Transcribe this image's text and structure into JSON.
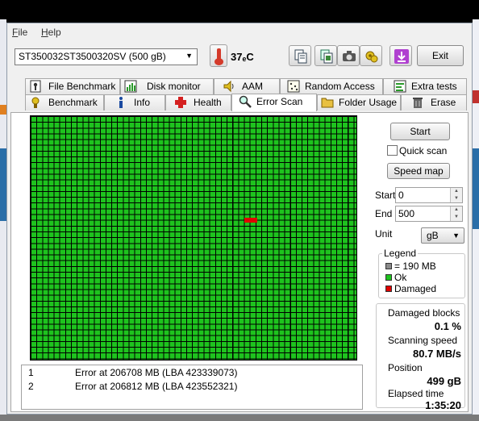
{
  "menu": {
    "file": "File",
    "file_u": "F",
    "file_rest": "ile",
    "help_u": "H",
    "help_rest": "elp"
  },
  "toolbar": {
    "drive": "ST350032ST3500320SV (500 gB)",
    "temperature": "37ₑC",
    "exit_label": "Exit",
    "icons": [
      "copy-icon",
      "copy-all-icon",
      "camera-icon",
      "options-icon",
      "save-icon"
    ]
  },
  "tabs": {
    "row1": [
      "File Benchmark",
      "Disk monitor",
      "AAM",
      "Random Access",
      "Extra tests"
    ],
    "row2": [
      "Benchmark",
      "Info",
      "Health",
      "Error Scan",
      "Folder Usage",
      "Erase"
    ],
    "active": "Error Scan"
  },
  "scan": {
    "grid_columns": 56,
    "grid_rows": 42,
    "ok_color": "#1ec31e",
    "damaged_color": "#e00000",
    "damaged_block_fraction": 0.001,
    "errors": [
      {
        "num": "1",
        "text": "Error at 206708 MB (LBA 423339073)"
      },
      {
        "num": "2",
        "text": "Error at 206812 MB (LBA 423552321)"
      }
    ]
  },
  "controls": {
    "start_label": "Start",
    "quick_scan_label": "Quick scan",
    "quick_scan_checked": false,
    "speed_map_label": "Speed map",
    "start_field_label": "Start",
    "start_value": "0",
    "end_field_label": "End",
    "end_value": "500",
    "unit_label": "Unit",
    "unit_value": "gB"
  },
  "legend": {
    "title": "Legend",
    "block_size": "= 190 MB",
    "ok": "Ok",
    "damaged": "Damaged"
  },
  "stats": {
    "damaged_blocks_label": "Damaged blocks",
    "damaged_blocks_value": "0.1 %",
    "scanning_speed_label": "Scanning speed",
    "scanning_speed_value": "80.7 MB/s",
    "position_label": "Position",
    "position_value": "499 gB",
    "elapsed_label": "Elapsed time",
    "elapsed_value": "1:35:20"
  }
}
